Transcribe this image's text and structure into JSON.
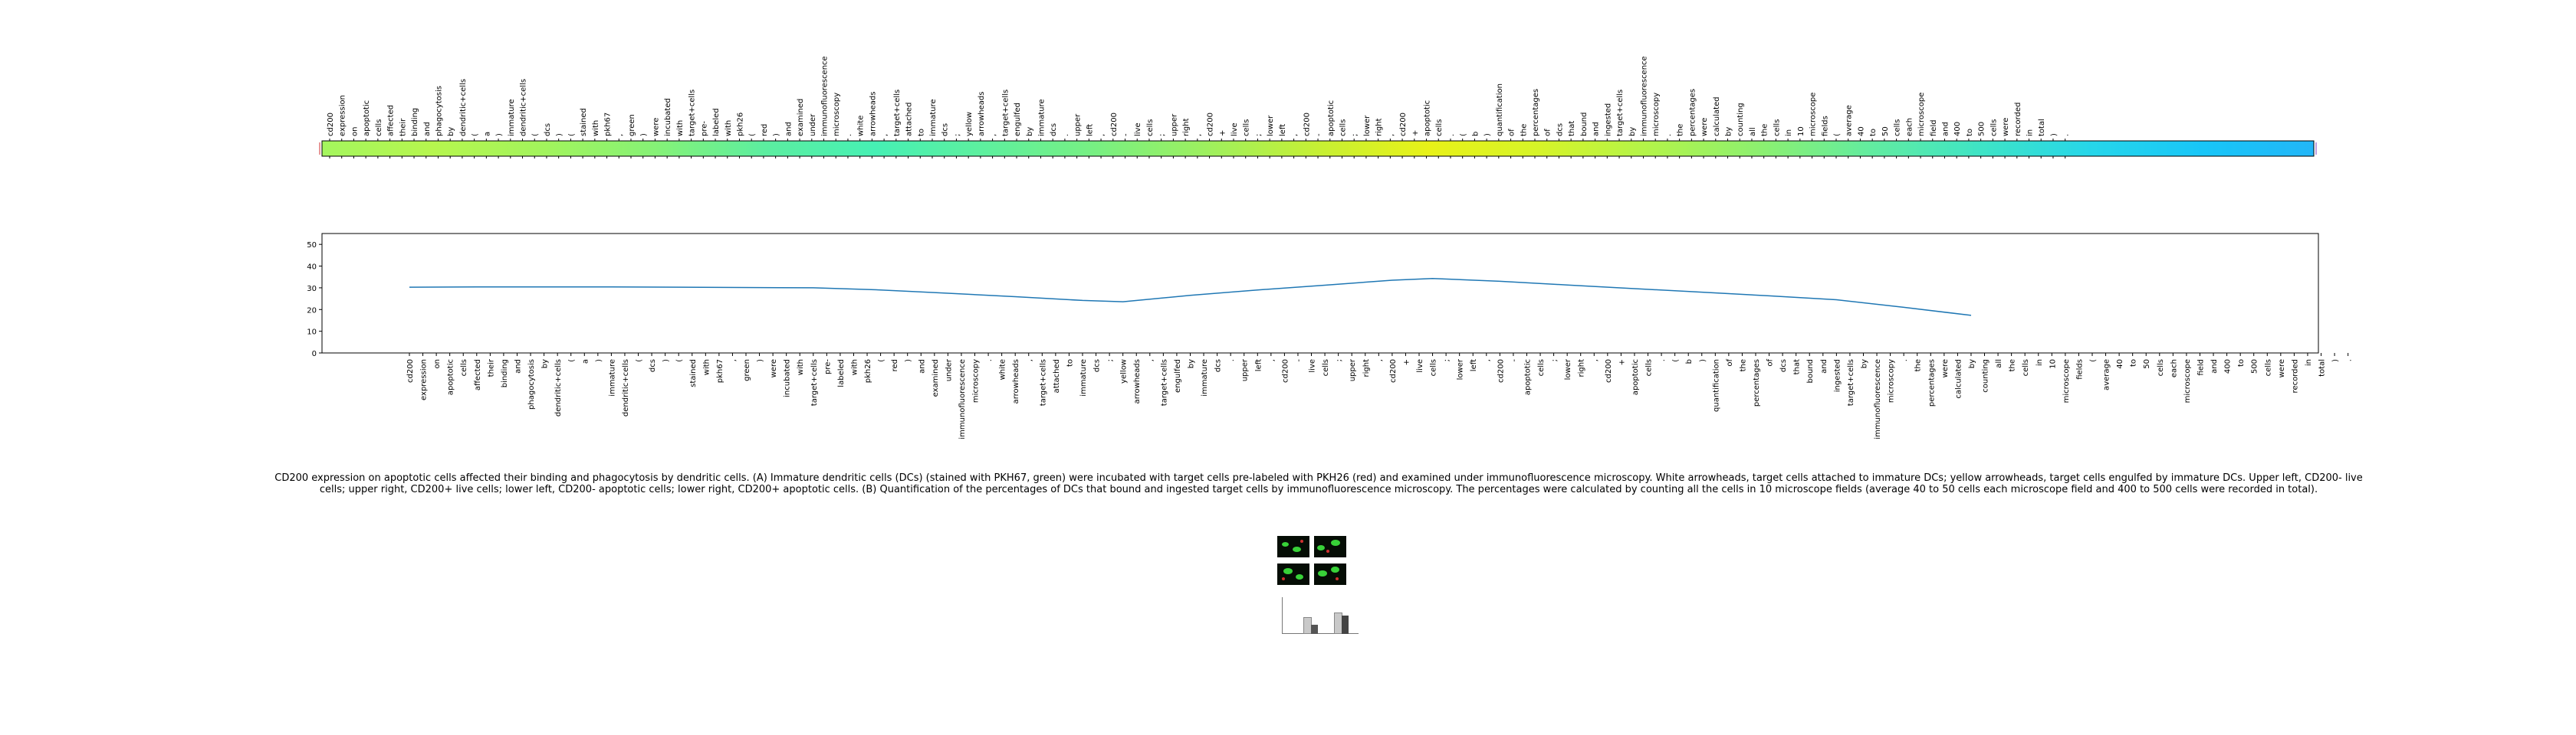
{
  "chart_data": {
    "type": "line",
    "words": [
      "cd200",
      "expression",
      "on",
      "apoptotic",
      "cells",
      "affected",
      "their",
      "binding",
      "and",
      "phagocytosis",
      "by",
      "dendritic+cells",
      "(",
      "a",
      ")",
      "immature",
      "dendritic+cells",
      "(",
      "dcs",
      ")",
      "(",
      "stained",
      "with",
      "pkh67",
      ",",
      "green",
      ")",
      "were",
      "incubated",
      "with",
      "target+cells",
      "pre-",
      "labeled",
      "with",
      "pkh26",
      "(",
      "red",
      ")",
      "and",
      "examined",
      "under",
      "immunofluorescence",
      "microscopy",
      ".",
      "white",
      "arrowheads",
      ",",
      "target+cells",
      "attached",
      "to",
      "immature",
      "dcs",
      ";",
      "yellow",
      "arrowheads",
      ",",
      "target+cells",
      "engulfed",
      "by",
      "immature",
      "dcs",
      ".",
      "upper",
      "left",
      ",",
      "cd200",
      "-",
      "live",
      "cells",
      ";",
      "upper",
      "right",
      ",",
      "cd200",
      "+",
      "live",
      "cells",
      ";",
      "lower",
      "left",
      ",",
      "cd200",
      "-",
      "apoptotic",
      "cells",
      ";",
      "lower",
      "right",
      ",",
      "cd200",
      "+",
      "apoptotic",
      "cells",
      ".",
      "(",
      "b",
      ")",
      "quantification",
      "of",
      "the",
      "percentages",
      "of",
      "dcs",
      "that",
      "bound",
      "and",
      "ingested",
      "target+cells",
      "by",
      "immunofluorescence",
      "microscopy",
      ".",
      "the",
      "percentages",
      "were",
      "calculated",
      "by",
      "counting",
      "all",
      "the",
      "cells",
      "in",
      "10",
      "microscope",
      "fields",
      "(",
      "average",
      "40",
      "to",
      "50",
      "cells",
      "each",
      "microscope",
      "field",
      "and",
      "400",
      "to",
      "500",
      "cells",
      "were",
      "recorded",
      "in",
      "total",
      ")",
      "."
    ],
    "x": [
      0,
      106
    ],
    "y": [
      30.3,
      30.4,
      30.4,
      30.0,
      29.0,
      27.5,
      25.9,
      24.2,
      23.6,
      26.5,
      29.0,
      31.2,
      33.5,
      34.3,
      33.0,
      31.3,
      29.6,
      28.0,
      26.3,
      24.5,
      21.0,
      17.3
    ],
    "line_x": [
      0,
      5,
      15,
      30,
      35,
      40,
      45,
      50,
      53,
      58,
      63,
      68,
      73,
      76,
      81,
      86,
      91,
      96,
      101,
      106,
      111,
      116
    ],
    "ylim": [
      0,
      55
    ],
    "yticks": [
      0,
      10,
      20,
      30,
      40,
      50
    ],
    "grid": false,
    "line_color": "#1f77b4",
    "colorbar_colors": [
      "#a4f65e",
      "#b6f64e",
      "#a2f45c",
      "#86f276",
      "#5ceea0",
      "#46f0b4",
      "#5ef09e",
      "#78f082",
      "#9ef05e",
      "#c6f034",
      "#e8f218",
      "#d6f428",
      "#b2f44a",
      "#8cf070",
      "#62eca0",
      "#3ee4c6",
      "#26d6ea",
      "#18c6f8",
      "#22b6f8"
    ]
  },
  "caption": "CD200 expression on apoptotic cells affected their binding and phagocytosis by dendritic cells. (A) Immature dendritic cells (DCs) (stained with PKH67, green) were incubated with target cells pre-labeled with PKH26 (red) and examined under immunofluorescence microscopy. White arrowheads, target cells attached to immature DCs; yellow arrowheads, target cells engulfed by immature DCs. Upper left, CD200- live cells; upper right, CD200+ live cells; lower left, CD200- apoptotic cells; lower right, CD200+ apoptotic cells. (B) Quantification of the percentages of DCs that bound and ingested target cells by immunofluorescence microscopy. The percentages were calculated by counting all the cells in 10 microscope fields (average 40 to 50 cells each microscope field and 400 to 500 cells were recorded in total)."
}
